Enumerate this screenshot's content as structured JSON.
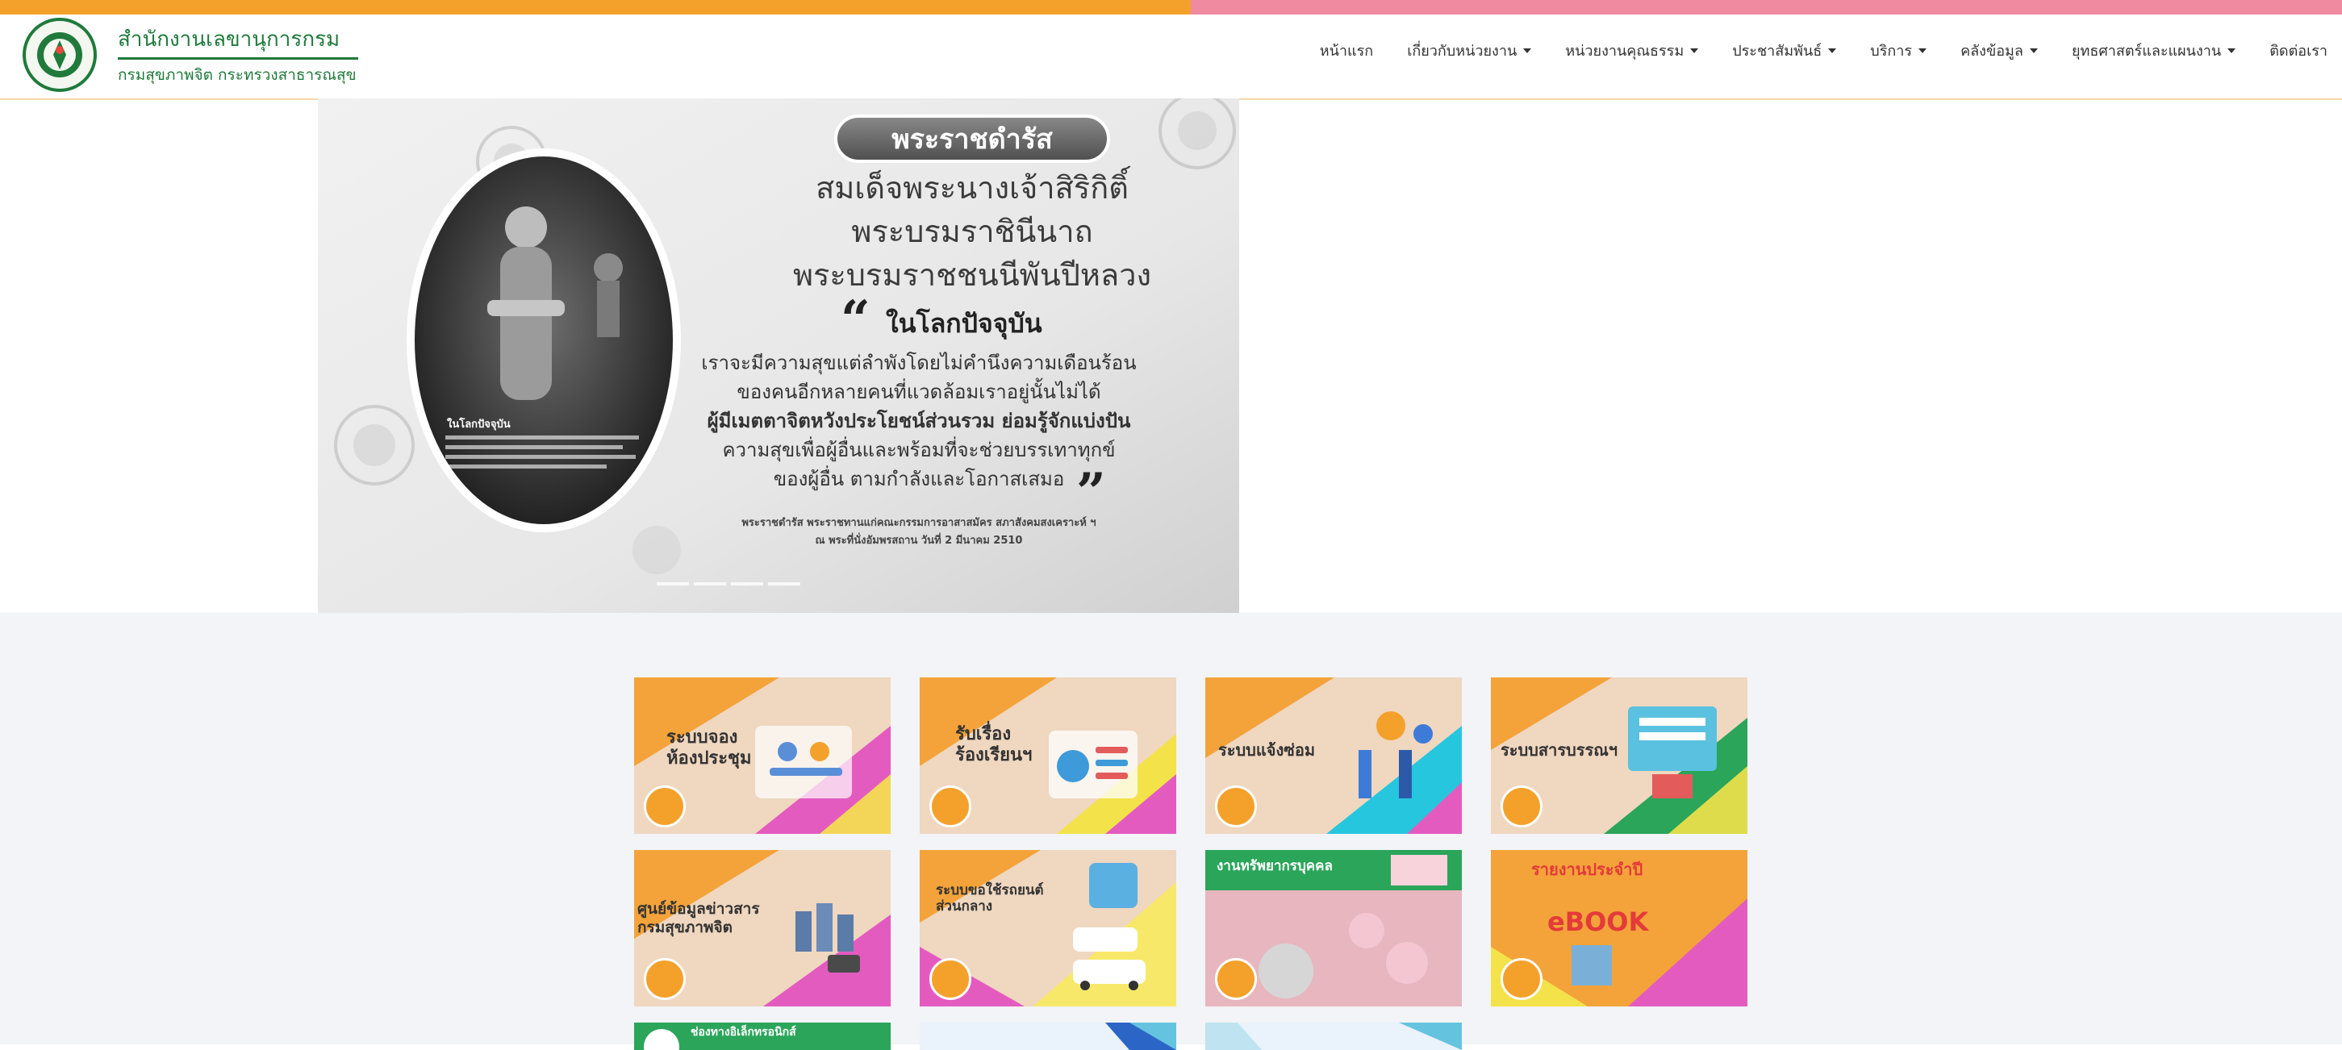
{
  "header": {
    "org_line1": "สำนักงานเลขานุการกรม",
    "org_line2": "กรมสุขภาพจิต กระทรวงสาธารณสุข",
    "nav": [
      {
        "label": "หน้าแรก",
        "dropdown": false
      },
      {
        "label": "เกี่ยวกับหน่วยงาน",
        "dropdown": true
      },
      {
        "label": "หน่วยงานคุณธรรม",
        "dropdown": true
      },
      {
        "label": "ประชาสัมพันธ์",
        "dropdown": true
      },
      {
        "label": "บริการ",
        "dropdown": true
      },
      {
        "label": "คลังข้อมูล",
        "dropdown": true
      },
      {
        "label": "ยุทธศาสตร์และแผนงาน",
        "dropdown": true
      },
      {
        "label": "ติดต่อเรา",
        "dropdown": false
      }
    ]
  },
  "banner": {
    "badge": "พระราชดำรัส",
    "title_lines": [
      "สมเด็จพระนางเจ้าสิริกิติ์",
      "พระบรมราชินีนาถ",
      "พระบรมราชชนนีพันปีหลวง"
    ],
    "quote_title": "ในโลกปัจจุบัน",
    "body_lines": [
      "เราจะมีความสุขแต่ลำพังโดยไม่คำนึงความเดือนร้อน",
      "ของคนอีกหลายคนที่แวดล้อมเราอยู่นั้นไม่ได้",
      "ผู้มีเมตตาจิตหวังประโยชน์ส่วนรวม ย่อมรู้จักแบ่งปัน",
      "ความสุขเพื่อผู้อื่นและพร้อมที่จะช่วยบรรเทาทุกข์",
      "ของผู้อื่น ตามกำลังและโอกาสเสมอ"
    ],
    "footer_lines": [
      "พระราชดำรัส พระราชทานแก่คณะกรรมการอาสาสมัคร สภาสังคมสงเคราะห์ ฯ",
      "ณ พระที่นั่งอัมพรสถาน วันที่ 2 มีนาคม 2510"
    ],
    "portrait_caption": "ในโลกปัจจุบัน"
  },
  "tiles": [
    {
      "title": "ระบบจอง\nห้องประชุม",
      "accent": "#e45bc0"
    },
    {
      "title": "รับเรื่อง\nร้องเรียนฯ",
      "accent": "#f3e24a"
    },
    {
      "title": "ระบบแจ้งซ่อม",
      "accent": "#27c6df"
    },
    {
      "title": "ระบบสารบรรณฯ",
      "accent": "#2aa55a"
    },
    {
      "title": "ศูนย์ข้อมูลข่าวสาร\nกรมสุขภาพจิต",
      "accent": "#e45bc0"
    },
    {
      "title": "ระบบขอใช้รถยนต์\nส่วนกลาง",
      "accent": "#f7e86a"
    },
    {
      "title": "งานทรัพยากรบุคคล",
      "accent": "#e59aa6"
    },
    {
      "title": "รายงานประจำปี",
      "accent": "#e45bc0"
    },
    {
      "title": "ช่องทางอิเล็กทรอนิกส์",
      "accent": "#1f7a3b"
    },
    {
      "title": "",
      "accent": "#2b66c7"
    },
    {
      "title": "",
      "accent": "#64c3df"
    }
  ]
}
